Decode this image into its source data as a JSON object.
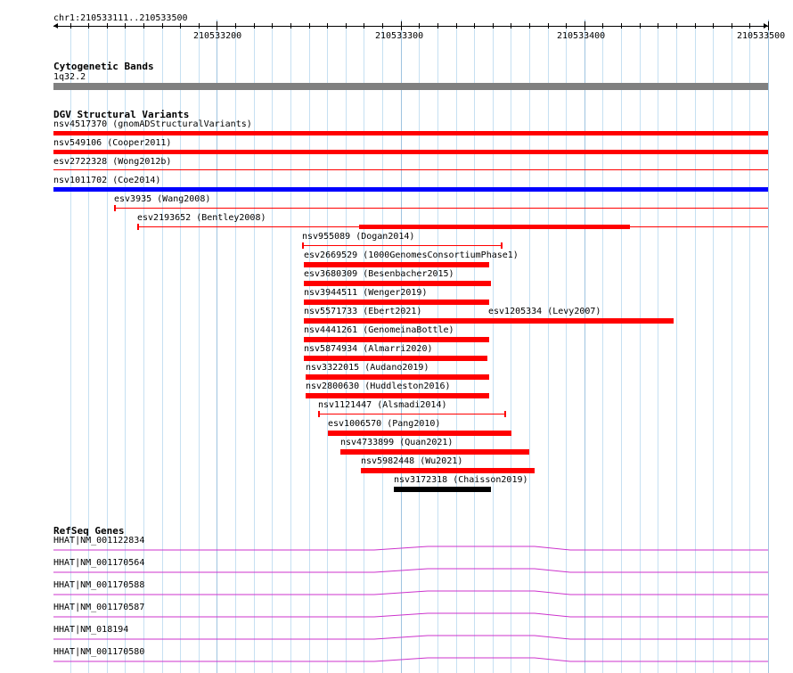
{
  "ruler": {
    "location": "chr1:210533111..210533500",
    "ticks": [
      "210533200",
      "210533300",
      "210533400",
      "210533500"
    ]
  },
  "cytoband": {
    "title": "Cytogenetic Bands",
    "band": "1q32.2",
    "color": "#808080"
  },
  "dgv": {
    "title": "DGV Structural Variants",
    "colors": {
      "loss": "#ff0000",
      "gain": "#0000ff",
      "other": "#000000"
    },
    "variants": [
      {
        "label": "nsv4517370 (gnomADStructuralVariants)",
        "color": "#ff0000"
      },
      {
        "label": "nsv549106 (Cooper2011)",
        "color": "#ff0000"
      },
      {
        "label": "esv2722328 (Wong2012b)",
        "color": "#ff0000"
      },
      {
        "label": "nsv1011702 (Coe2014)",
        "color": "#0000ff"
      },
      {
        "label": "esv3935 (Wang2008)",
        "color": "#ff0000"
      },
      {
        "label": "esv2193652 (Bentley2008)",
        "color": "#ff0000"
      },
      {
        "label": "nsv955089 (Dogan2014)",
        "color": "#ff0000"
      },
      {
        "label": "esv2669529 (1000GenomesConsortiumPhase1)",
        "color": "#ff0000"
      },
      {
        "label": "esv3680309 (Besenbacher2015)",
        "color": "#ff0000"
      },
      {
        "label": "nsv3944511 (Wenger2019)",
        "color": "#ff0000"
      },
      {
        "label": "nsv5571733 (Ebert2021)",
        "color": "#ff0000"
      },
      {
        "label": "esv1205334 (Levy2007)",
        "color": "#ff0000"
      },
      {
        "label": "nsv4441261 (GenomeinaBottle)",
        "color": "#ff0000"
      },
      {
        "label": "nsv5874934 (Almarri2020)",
        "color": "#ff0000"
      },
      {
        "label": "nsv3322015 (Audano2019)",
        "color": "#ff0000"
      },
      {
        "label": "nsv2800630 (Huddleston2016)",
        "color": "#ff0000"
      },
      {
        "label": "nsv1121447 (Alsmadi2014)",
        "color": "#ff0000"
      },
      {
        "label": "esv1006570 (Pang2010)",
        "color": "#ff0000"
      },
      {
        "label": "nsv4733899 (Quan2021)",
        "color": "#ff0000"
      },
      {
        "label": "nsv5982448 (Wu2021)",
        "color": "#ff0000"
      },
      {
        "label": "nsv3172318 (Chaisson2019)",
        "color": "#000000"
      }
    ]
  },
  "refseq": {
    "title": "RefSeq Genes",
    "color": "#cc33cc",
    "genes": [
      {
        "label": "HHAT|NM_001122834"
      },
      {
        "label": "HHAT|NM_001170564"
      },
      {
        "label": "HHAT|NM_001170588"
      },
      {
        "label": "HHAT|NM_001170587"
      },
      {
        "label": "HHAT|NM_018194"
      },
      {
        "label": "HHAT|NM_001170580"
      }
    ]
  }
}
